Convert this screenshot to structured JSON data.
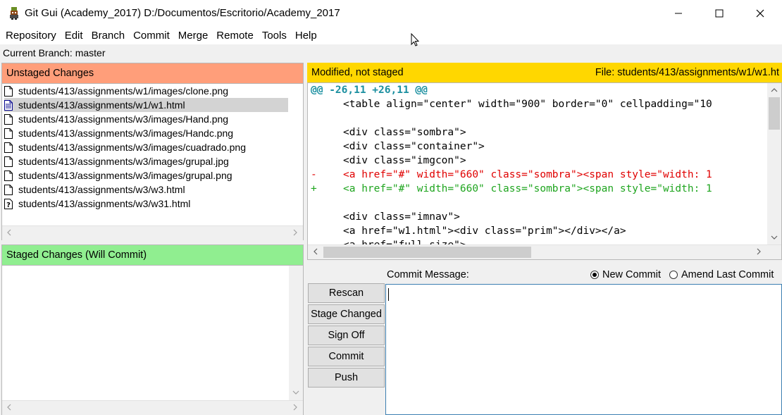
{
  "window": {
    "title": "Git Gui (Academy_2017) D:/Documentos/Escritorio/Academy_2017"
  },
  "menu": [
    "Repository",
    "Edit",
    "Branch",
    "Commit",
    "Merge",
    "Remote",
    "Tools",
    "Help"
  ],
  "branch_label": "Current Branch: master",
  "unstaged": {
    "title": "Unstaged Changes",
    "files": [
      {
        "name": "students/413/assignments/w1/images/clone.png",
        "icon": "file-icon",
        "selected": false
      },
      {
        "name": "students/413/assignments/w1/w1.html",
        "icon": "modified-file-icon",
        "selected": true
      },
      {
        "name": "students/413/assignments/w3/images/Hand.png",
        "icon": "file-icon",
        "selected": false
      },
      {
        "name": "students/413/assignments/w3/images/Handc.png",
        "icon": "file-icon",
        "selected": false
      },
      {
        "name": "students/413/assignments/w3/images/cuadrado.png",
        "icon": "file-icon",
        "selected": false
      },
      {
        "name": "students/413/assignments/w3/images/grupal.jpg",
        "icon": "file-icon",
        "selected": false
      },
      {
        "name": "students/413/assignments/w3/images/grupal.png",
        "icon": "file-icon",
        "selected": false
      },
      {
        "name": "students/413/assignments/w3/w3.html",
        "icon": "file-icon",
        "selected": false
      },
      {
        "name": "students/413/assignments/w3/w31.html",
        "icon": "untracked-file-icon",
        "selected": false
      }
    ]
  },
  "staged": {
    "title": "Staged Changes (Will Commit)"
  },
  "diff": {
    "status": "Modified, not staged",
    "file_label": "File:  students/413/assignments/w1/w1.ht",
    "lines": [
      {
        "type": "hunk",
        "marker": "",
        "text": "@@ -26,11 +26,11 @@"
      },
      {
        "type": "ctx",
        "marker": "",
        "text": "<table align=\"center\" width=\"900\" border=\"0\" cellpadding=\"10"
      },
      {
        "type": "ctx",
        "marker": "",
        "text": ""
      },
      {
        "type": "ctx",
        "marker": "",
        "text": "<div class=\"sombra\">"
      },
      {
        "type": "ctx",
        "marker": "",
        "text": "<div class=\"container\">"
      },
      {
        "type": "ctx",
        "marker": "",
        "text": "<div class=\"imgcon\">"
      },
      {
        "type": "del",
        "marker": "-",
        "text": "<a href=\"#\" width=\"660\" class=\"sombra\"><span style=\"width: 1"
      },
      {
        "type": "add",
        "marker": "+",
        "text": "<a href=\"#\" width=\"660\" class=\"sombra\"><span style=\"width: 1"
      },
      {
        "type": "ctx",
        "marker": "",
        "text": ""
      },
      {
        "type": "ctx",
        "marker": "",
        "text": "<div class=\"imnav\">"
      },
      {
        "type": "ctx",
        "marker": "",
        "text": "<a href=\"w1.html\"><div class=\"prim\"></div></a>"
      },
      {
        "type": "ctx",
        "marker": "",
        "text": "<a href=\"full size\">"
      }
    ]
  },
  "commit": {
    "message_label": "Commit Message:",
    "new_commit_label": "New Commit",
    "amend_label": "Amend Last Commit",
    "new_commit_selected": true,
    "message_value": "",
    "buttons": {
      "rescan": "Rescan",
      "stage_changed": "Stage Changed",
      "sign_off": "Sign Off",
      "commit": "Commit",
      "push": "Push"
    }
  },
  "colors": {
    "unstaged_header": "#ff9e7a",
    "staged_header": "#90ee90",
    "diff_header": "#ffd700",
    "hunk": "#1a8fa0",
    "deleted": "#e00000",
    "added": "#1fa51f"
  }
}
